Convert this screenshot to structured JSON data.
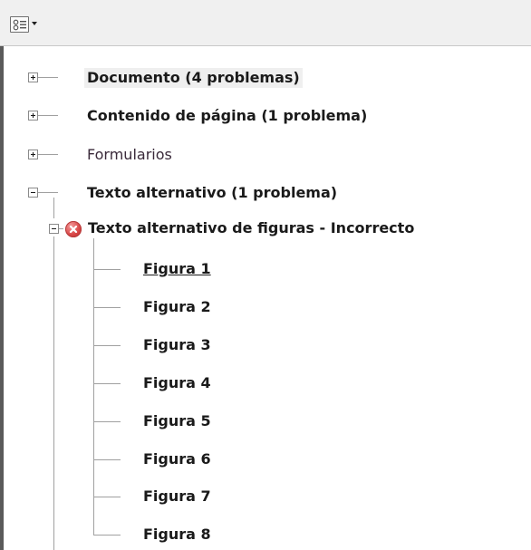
{
  "toolbar": {
    "options_icon": "options-menu-icon"
  },
  "tree": {
    "categories": [
      {
        "label": "Documento (4 problemas)",
        "expanded": false,
        "selected": true
      },
      {
        "label": "Contenido de página (1 problema)",
        "expanded": false
      },
      {
        "label": "Formularios",
        "expanded": false
      },
      {
        "label": "Texto alternativo (1 problema)",
        "expanded": true
      }
    ],
    "check": {
      "label": "Texto alternativo de figuras - Incorrecto",
      "status_icon": "error-icon",
      "status_color": "#d94848"
    },
    "figures": [
      "Figura 1",
      "Figura 2",
      "Figura 3",
      "Figura 4",
      "Figura 5",
      "Figura 6",
      "Figura 7",
      "Figura 8"
    ]
  }
}
